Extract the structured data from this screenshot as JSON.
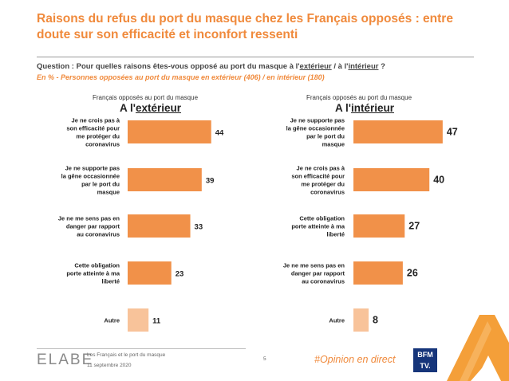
{
  "colors": {
    "accent": "#f08a3c",
    "bar_main": "#f19149",
    "bar_other": "#f8c39a",
    "text": "#222222",
    "logo_orange": "#e8731e",
    "logo_gray": "#8a8a8a",
    "bfm_blue": "#16357a"
  },
  "header": {
    "title": "Raisons du refus du port du masque chez les Français opposés : entre doute sur son efficacité et inconfort ressenti",
    "question_prefix": "Question : Pour quelles raisons êtes-vous opposé au port du masque à l'",
    "question_ext": "extérieur",
    "question_mid": " / à l'",
    "question_int": "intérieur",
    "question_suffix": " ?",
    "note": "En  % - Personnes opposées au port du masque en extérieur (406) / en intérieur (180)"
  },
  "panels": {
    "left": {
      "subhead": "Français opposés au port du masque",
      "head_prefix": "A l'",
      "head_word": "extérieur"
    },
    "right": {
      "subhead": "Français opposés au port du masque",
      "head_prefix": "A l'",
      "head_word": "intérieur"
    }
  },
  "chart_data": [
    {
      "type": "bar",
      "orientation": "horizontal",
      "title": "A l'extérieur",
      "subtitle": "Français opposés au port du masque",
      "unit": "%",
      "categories": [
        "Je ne crois pas à son efficacité pour me protéger du coronavirus",
        "Je ne supporte pas la gêne occasionnée par le port du masque",
        "Je ne me sens pas en danger par rapport au coronavirus",
        "Cette obligation porte atteinte à ma liberté",
        "Autre"
      ],
      "values": [
        44,
        39,
        33,
        23,
        11
      ],
      "grid": false,
      "data_labels": true
    },
    {
      "type": "bar",
      "orientation": "horizontal",
      "title": "A l'intérieur",
      "subtitle": "Français opposés au port du masque",
      "unit": "%",
      "categories": [
        "Je ne supporte pas la gêne occasionnée par le port du masque",
        "Je ne crois pas à son efficacité pour me protéger du coronavirus",
        "Cette obligation porte atteinte à ma liberté",
        "Je ne me sens pas en danger par rapport au coronavirus",
        "Autre"
      ],
      "values": [
        47,
        40,
        27,
        26,
        8
      ],
      "grid": false,
      "data_labels": true
    }
  ],
  "footer": {
    "logo": "ELABE",
    "study_title": "Les Français et le port du masque",
    "date": "11 septembre 2020",
    "page_number": "5",
    "hashtag": "#Opinion en direct",
    "bfm_line1": "BFM",
    "bfm_line2": "TV."
  }
}
